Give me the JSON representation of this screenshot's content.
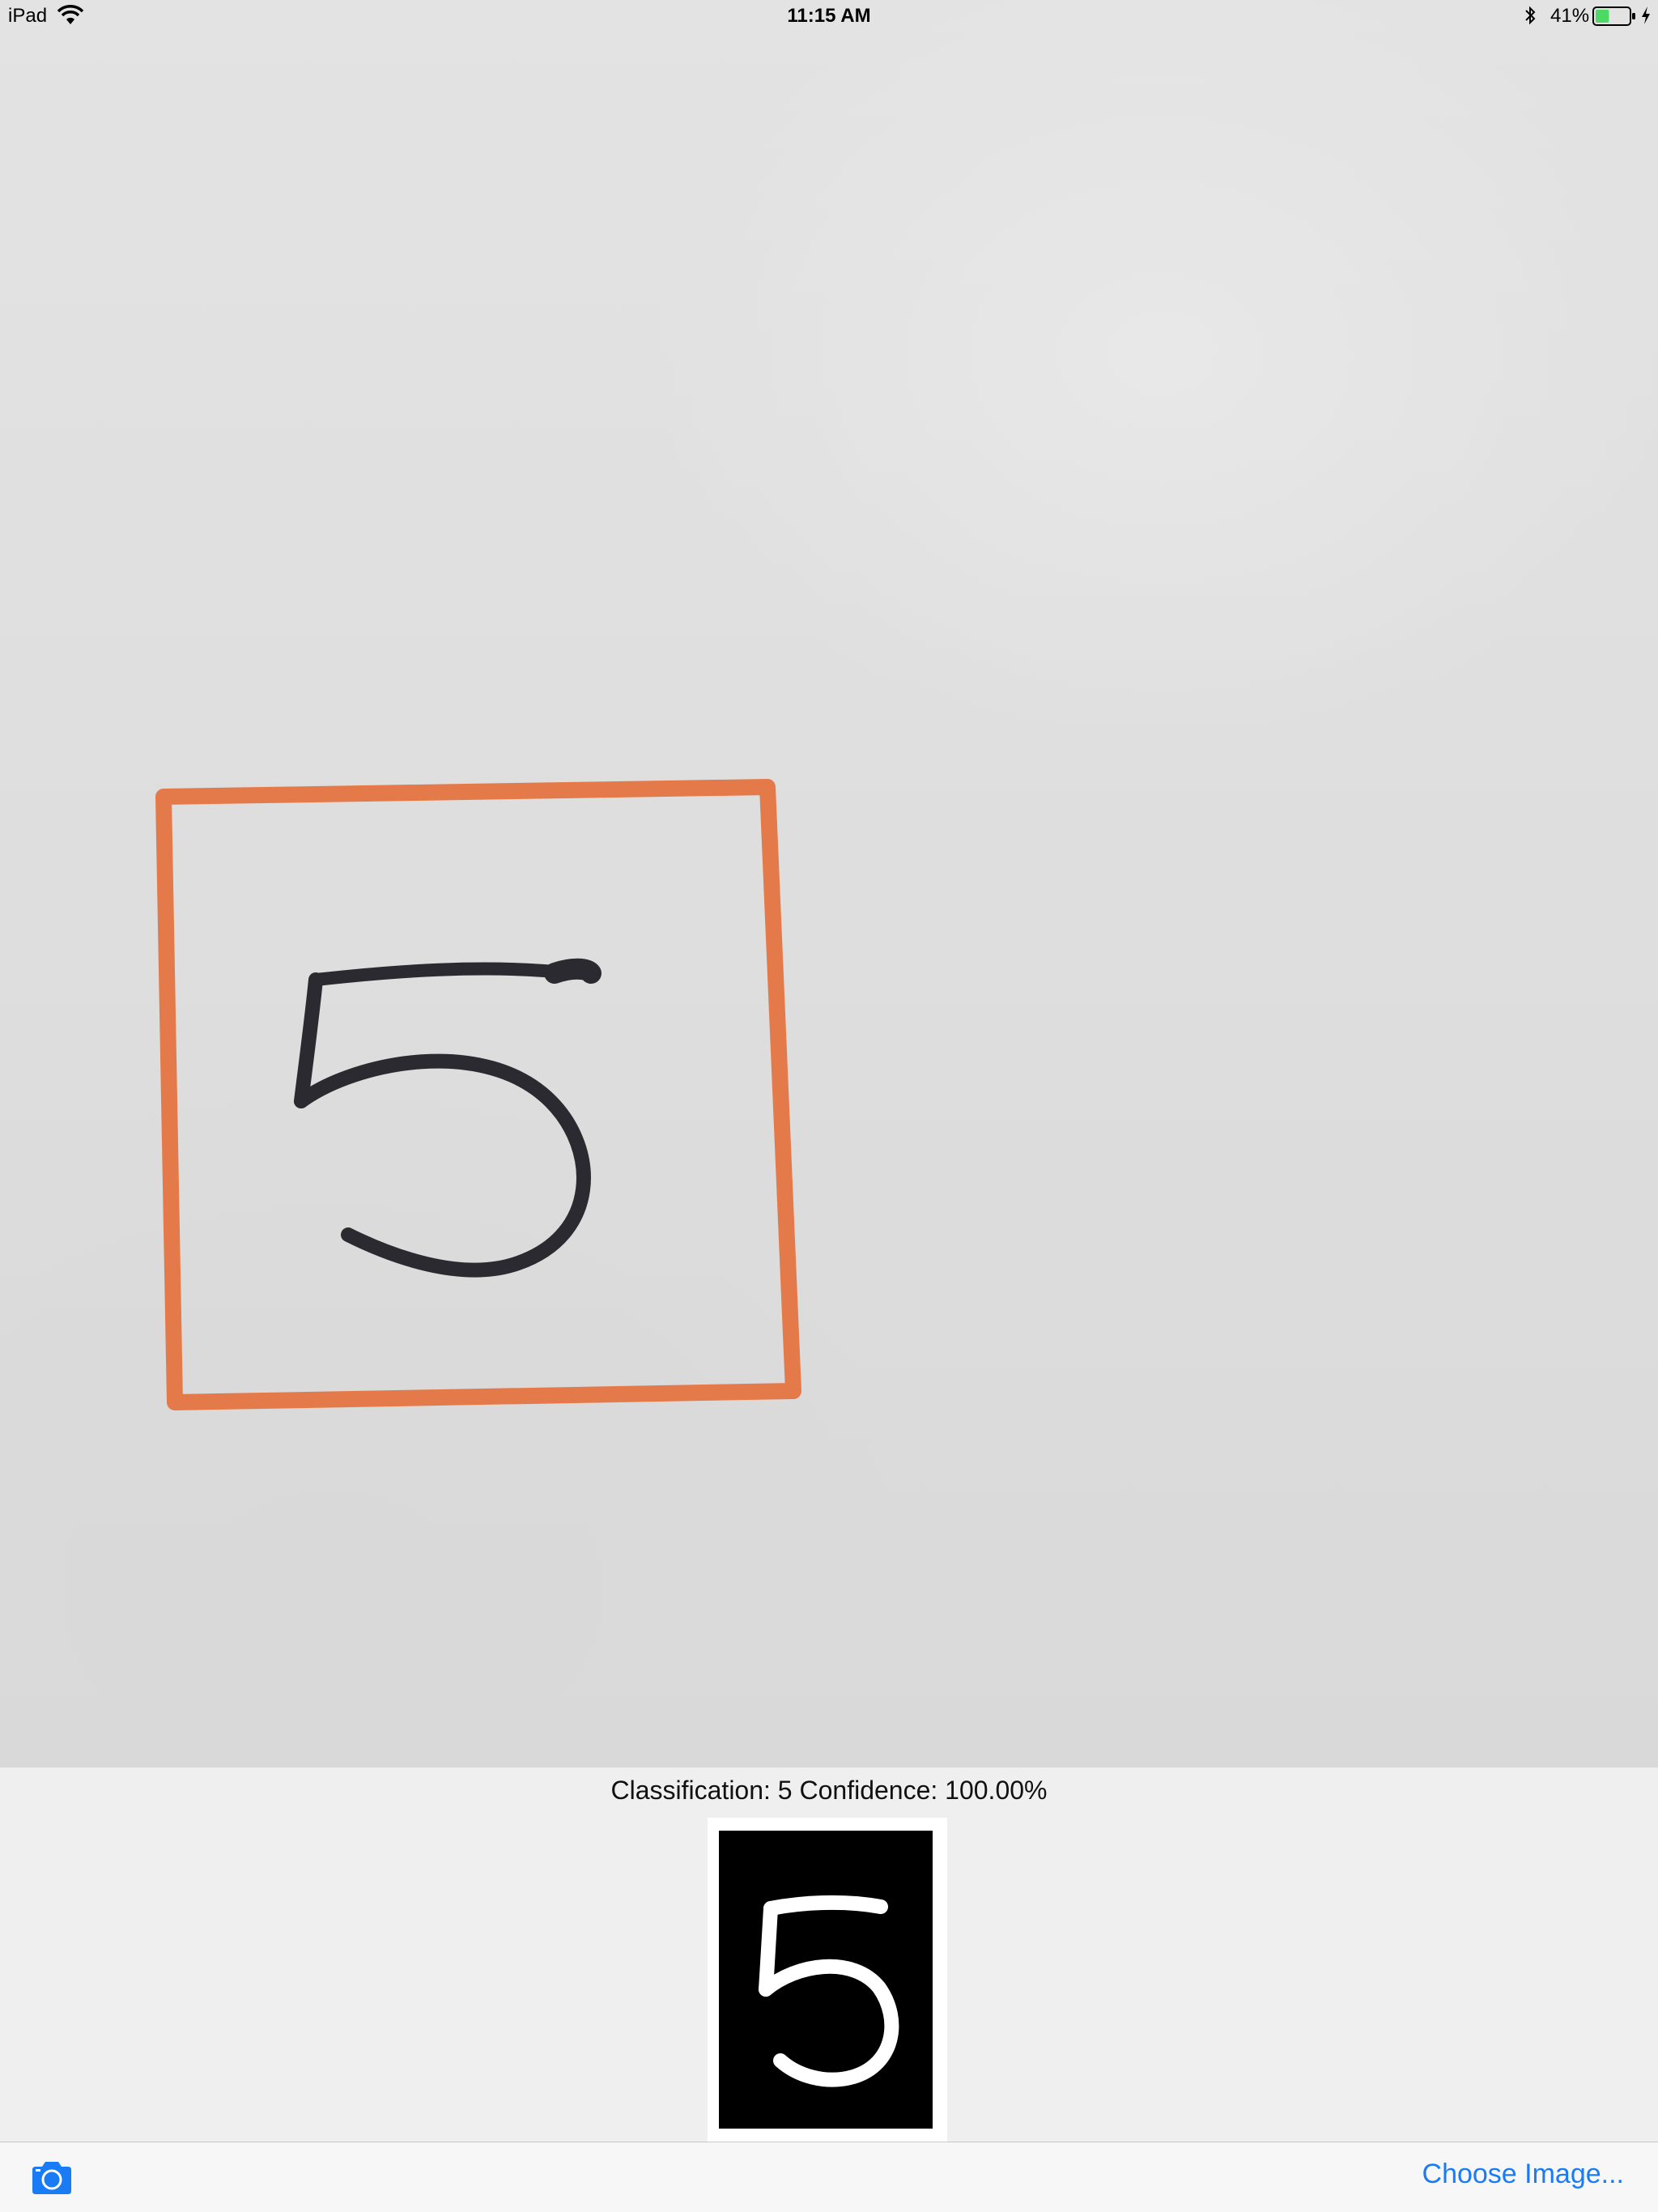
{
  "status_bar": {
    "device": "iPad",
    "time": "11:15 AM",
    "battery_percent": "41%",
    "battery_level": 0.41
  },
  "photo": {
    "digit": "5"
  },
  "result": {
    "classification_text": "Classification: 5 Confidence: 100.00%",
    "processed_digit": "5"
  },
  "toolbar": {
    "camera_icon": "camera-icon",
    "choose_image_label": "Choose Image..."
  },
  "colors": {
    "accent": "#1a7cf5",
    "marker_box": "#e47a4a",
    "ink": "#2a2a30",
    "battery_fill": "#4cd964"
  }
}
